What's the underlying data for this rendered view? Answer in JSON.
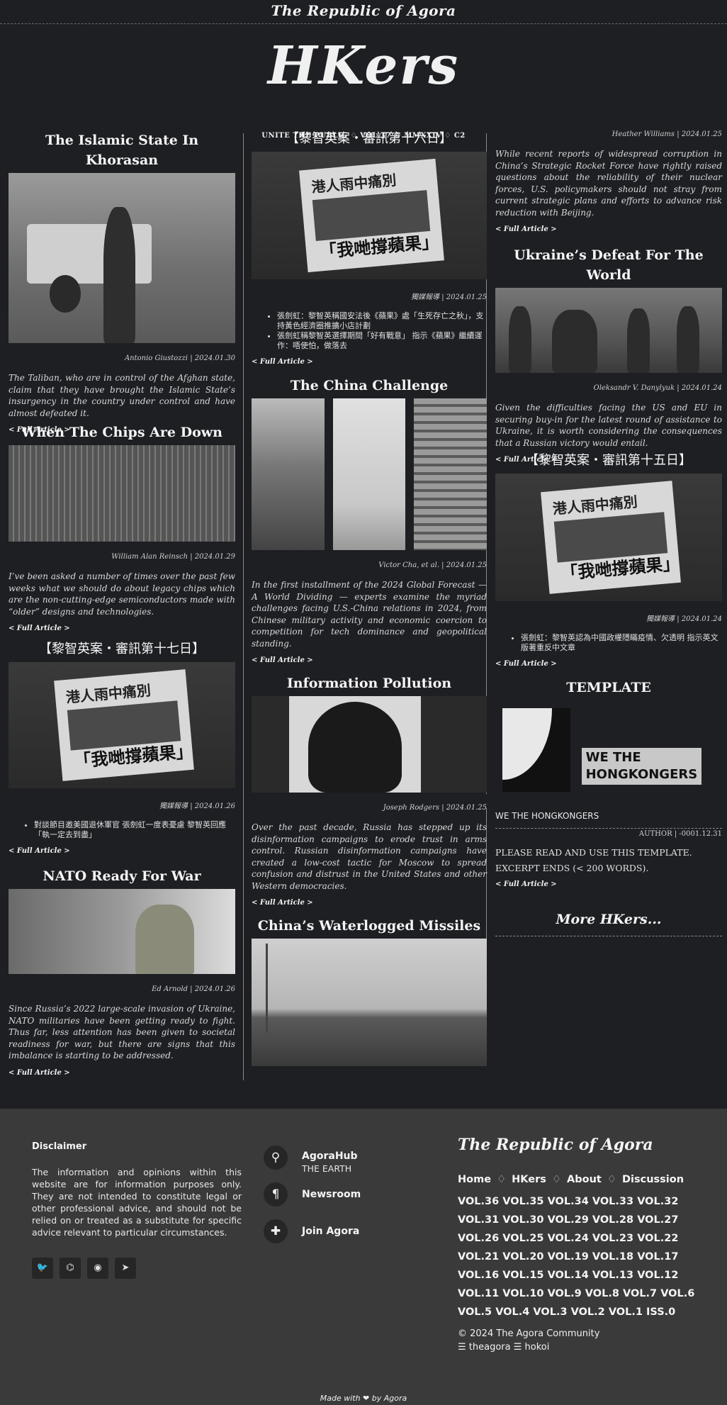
{
  "site": {
    "brand": "The Republic of Agora",
    "logo": "HKers",
    "tagline": "UNITE THE PUBLIC ♢ VOL.37 © MMXXIV ♢ C2"
  },
  "col1": {
    "a1": {
      "title": "The Islamic State In Khorasan",
      "byline": "Antonio Giustozzi | 2024.01.30",
      "summary": "The Taliban, who are in control of the Afghan state, claim that they have brought the Islamic State’s insurgency in the country under control and have almost defeated it.",
      "more": "< Full Article >"
    },
    "a2": {
      "title": "When The Chips Are Down",
      "byline": "William Alan Reinsch | 2024.01.29",
      "summary": "I’ve been asked a number of times over the past few weeks what we should do about legacy chips which are the non-cutting-edge semiconductors made with “older” designs and technologies.",
      "more": "< Full Article >"
    },
    "a3": {
      "title": "【黎智英案・審訊第十七日】",
      "byline": "獨媒報導 | 2024.01.26",
      "photo_top": "港人雨中痛別",
      "photo_bottom": "「我哋撐蘋果」",
      "bullets": [
        "對談節目邀美國退休軍官 張劍虹一度表憂慮 黎智英回應「執一定去到盡」"
      ],
      "more": "< Full Article >"
    },
    "a4": {
      "title": "NATO Ready For War",
      "byline": "Ed Arnold | 2024.01.26",
      "summary": "Since Russia’s 2022 large-scale invasion of Ukraine, NATO militaries have been getting ready to fight. Thus far, less attention has been given to societal readiness for war, but there are signs that this imbalance is starting to be addressed.",
      "more": "< Full Article >"
    }
  },
  "col2": {
    "a1": {
      "title": "【黎智英案・審訊第十六日】",
      "byline": "獨媒報導 | 2024.01.25",
      "photo_top": "港人雨中痛別",
      "photo_bottom": "「我哋撐蘋果」",
      "bullets": [
        "張劍虹：黎智英稱國安法後《蘋果》處「生死存亡之秋」，支持黃色經濟圈推擴小店計劃",
        "張劍虹稱黎智英選擇期間「好有戰意」 指示《蘋果》繼續運作：唔使怕，做落去"
      ],
      "more": "< Full Article >"
    },
    "a2": {
      "title": "The China Challenge",
      "byline": "Victor Cha, et al. | 2024.01.25",
      "summary": "In the first installment of the 2024 Global Forecast — A World Dividing — experts examine the myriad challenges facing U.S.-China relations in 2024, from Chinese military activity and economic coercion to competition for tech dominance and geopolitical standing.",
      "more": "< Full Article >"
    },
    "a3": {
      "title": "Information Pollution",
      "byline": "Joseph Rodgers | 2024.01.25",
      "summary": "Over the past decade, Russia has stepped up its disinformation campaigns to erode trust in arms control. Russian disinformation campaigns have created a low-cost tactic for Moscow to spread confusion and distrust in the United States and other Western democracies.",
      "more": "< Full Article >"
    },
    "a4": {
      "title": "China’s Waterlogged Missiles"
    }
  },
  "col3": {
    "a0": {
      "byline": "Heather Williams | 2024.01.25",
      "summary": "While recent reports of widespread corruption in China’s Strategic Rocket Force have rightly raised questions about the reliability of their nuclear forces, U.S. policymakers should not stray from current strategic plans and efforts to advance risk reduction with Beijing.",
      "more": "< Full Article >"
    },
    "a1": {
      "title": "Ukraine’s Defeat For The World",
      "byline": "Oleksandr V. Danylyuk | 2024.01.24",
      "summary": "Given the difficulties facing the US and EU in securing buy-in for the latest round of assistance to Ukraine, it is worth considering the consequences that a Russian victory would entail.",
      "more": "< Full Article >"
    },
    "a2": {
      "title": "【黎智英案・審訊第十五日】",
      "byline": "獨媒報導 | 2024.01.24",
      "photo_top": "港人雨中痛別",
      "photo_bottom": "「我哋撐蘋果」",
      "bullets": [
        "張劍虹：黎智英認為中國政權隱瞞疫情、欠透明 指示英文版著重反中文章"
      ],
      "more": "< Full Article >"
    },
    "a3": {
      "title": "TEMPLATE",
      "image_text_1": "WE THE",
      "image_text_2": "HONGKONGERS",
      "caption": "WE THE HONGKONGERS",
      "byline": "AUTHOR | -0001.12.31",
      "line1": "PLEASE READ AND USE THIS TEMPLATE.",
      "line2": "EXCERPT ENDS (< 200 WORDS).",
      "more": "< Full Article >"
    },
    "more_hkers": "More HKers..."
  },
  "footer": {
    "disclaimer_title": "Disclaimer",
    "disclaimer_text": "The information and opinions within this website are for information purposes only. They are not intended to constitute legal or other professional advice, and should not be relied on or treated as a substitute for specific advice relevant to particular circumstances.",
    "socials": [
      {
        "icon": "twitter-icon",
        "glyph": "🐦"
      },
      {
        "icon": "github-icon",
        "glyph": "⌬"
      },
      {
        "icon": "reddit-icon",
        "glyph": "◉"
      },
      {
        "icon": "telegram-icon",
        "glyph": "➤"
      }
    ],
    "contacts": [
      {
        "icon": "location-pin-icon",
        "glyph": "⚲",
        "label": "AgoraHub",
        "sub": "THE EARTH"
      },
      {
        "icon": "pilcrow-icon",
        "glyph": "¶",
        "label": "Newsroom",
        "sub": ""
      },
      {
        "icon": "puzzle-icon",
        "glyph": "✚",
        "label": "Join Agora",
        "sub": ""
      }
    ],
    "brand": "The Republic of Agora",
    "nav": [
      "Home",
      "HKers",
      "About",
      "Discussion"
    ],
    "nav_sep": "♢",
    "volumes": [
      "VOL.36",
      "VOL.35",
      "VOL.34",
      "VOL.33",
      "VOL.32",
      "VOL.31",
      "VOL.30",
      "VOL.29",
      "VOL.28",
      "VOL.27",
      "VOL.26",
      "VOL.25",
      "VOL.24",
      "VOL.23",
      "VOL.22",
      "VOL.21",
      "VOL.20",
      "VOL.19",
      "VOL.18",
      "VOL.17",
      "VOL.16",
      "VOL.15",
      "VOL.14",
      "VOL.13",
      "VOL.12",
      "VOL.11",
      "VOL.10",
      "VOL.9",
      "VOL.8",
      "VOL.7",
      "VOL.6",
      "VOL.5",
      "VOL.4",
      "VOL.3",
      "VOL.2",
      "VOL.1",
      "ISS.0"
    ],
    "copyright": "© 2024 The Agora Community",
    "links": "☰ theagora ☰ hokoi",
    "made_with": "Made with ❤ by Agora"
  }
}
